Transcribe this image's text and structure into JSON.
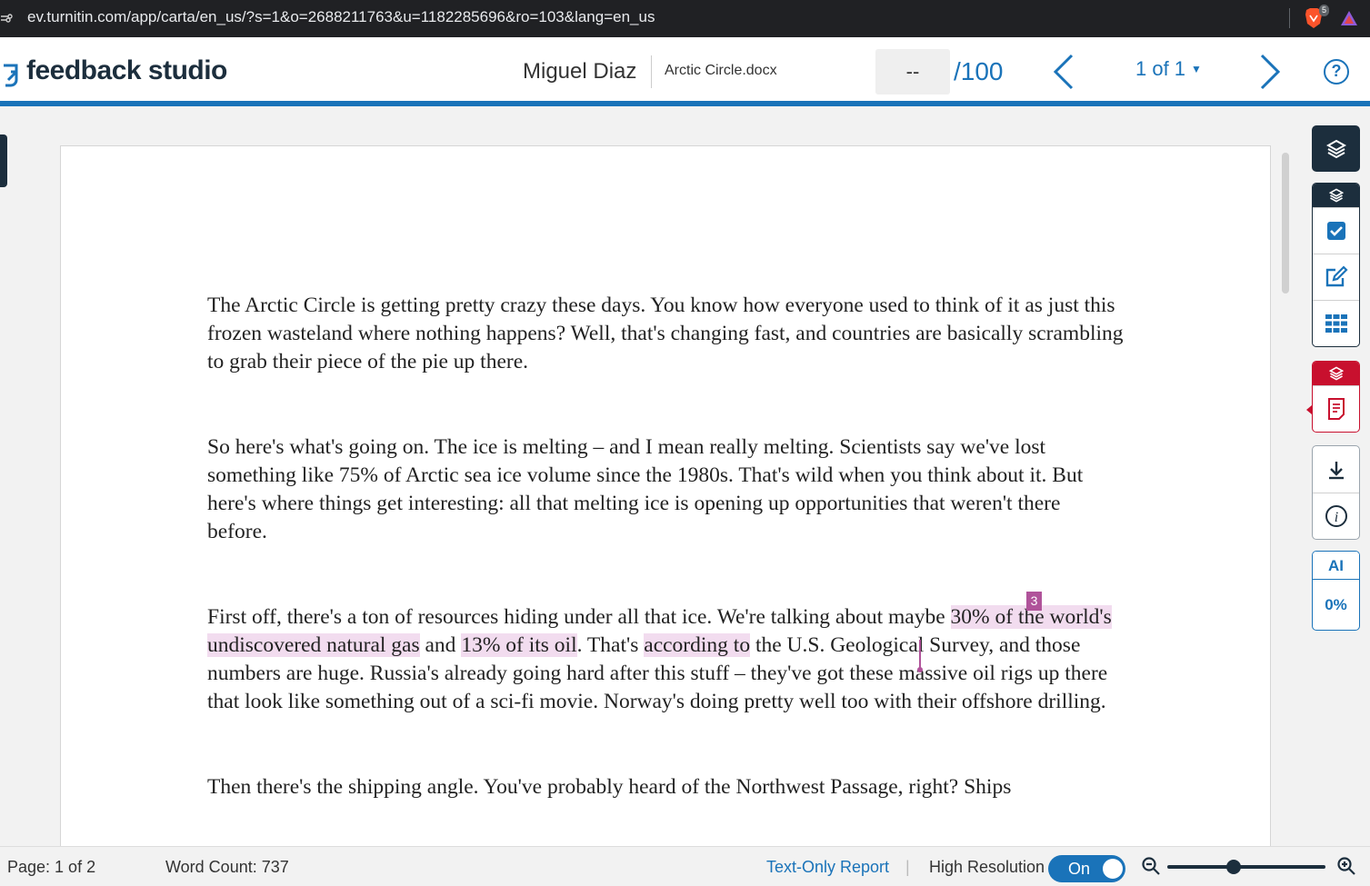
{
  "browser": {
    "url": "ev.turnitin.com/app/carta/en_us/?s=1&o=2688211763&u=1182285696&ro=103&lang=en_us",
    "extension_badge": "5"
  },
  "header": {
    "logo": "feedback studio",
    "student_name": "Miguel Diaz",
    "file_name": "Arctic Circle.docx",
    "grade_value": "--",
    "grade_out_of": "/100",
    "pager": "1 of 1",
    "help": "?"
  },
  "document": {
    "p1": "The Arctic Circle is getting pretty crazy these days. You know how everyone used to think of it as just this frozen wasteland where nothing happens? Well, that's changing fast, and countries are basically scrambling to grab their piece of the pie up there.",
    "p2": "So here's what's going on. The ice is melting – and I mean really melting. Scientists say we've lost something like 75% of Arctic sea ice volume since the 1980s. That's wild when you think about it. But here's where things get interesting: all that melting ice is opening up opportunities that weren't there before.",
    "p3": {
      "t1": "First off, there's a ton of resources hiding under all that ice. We're talking about maybe ",
      "h1": "30% of the world's undiscovered natural gas",
      "t2": " and ",
      "h2": "13% of its oil",
      "t3": ". That's ",
      "h3": "according to",
      "t4": " the U.S. Geological Survey, and those numbers are huge. Russia's already going hard after this stuff – they've got these massive oil rigs up there that look like something out of a sci-fi movie. Norway's doing pretty well too with their offshore drilling.",
      "match_number": "3"
    },
    "p4": "Then there's the shipping angle. You've probably heard of the Northwest Passage, right? Ships"
  },
  "toolbar": {
    "ai_label": "AI",
    "ai_value": "0%"
  },
  "status": {
    "page": "Page: 1 of 2",
    "word_count": "Word Count: 737",
    "text_only_report": "Text-Only Report",
    "separator": "|",
    "high_resolution": "High Resolution",
    "toggle_state": "On",
    "zoom_fraction": 0.42
  },
  "colors": {
    "brand_blue": "#1a73b9",
    "dark_navy": "#1c2e3d",
    "highlight_pink": "#f2dcef",
    "match_purple": "#b0539a",
    "similarity_red": "#c8102e"
  }
}
